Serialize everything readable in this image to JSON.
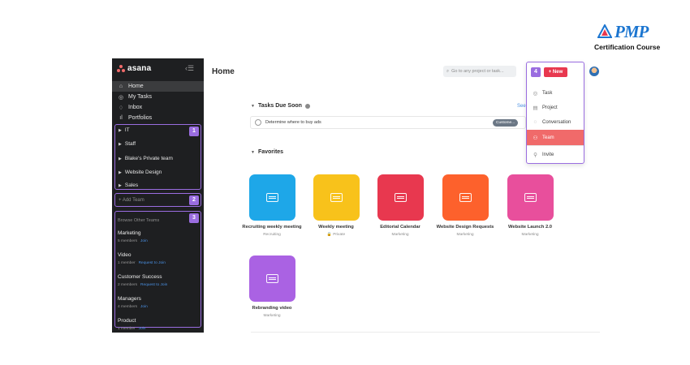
{
  "brand": {
    "name": "PMP",
    "subtitle": "Certification Course",
    "color": "#1b75d0"
  },
  "app": {
    "logo": "asana",
    "accent": "#f06a6a",
    "highlight_color": "#9a6de0"
  },
  "sidebar": {
    "nav": [
      {
        "label": "Home",
        "icon": "home-icon",
        "active": true
      },
      {
        "label": "My Tasks",
        "icon": "check-circle-icon",
        "active": false
      },
      {
        "label": "Inbox",
        "icon": "bell-icon",
        "active": false
      },
      {
        "label": "Portfolios",
        "icon": "bar-chart-icon",
        "active": false
      }
    ],
    "teams": [
      "IT",
      "Staff",
      "Blake's Private team",
      "Website Design",
      "Sales"
    ],
    "add_team": "+ Add Team",
    "browse_header": "Browse Other Teams",
    "browse": [
      {
        "name": "Marketing",
        "meta": "5 members",
        "action": "Join"
      },
      {
        "name": "Video",
        "meta": "1 member",
        "action": "Request to Join"
      },
      {
        "name": "Customer Success",
        "meta": "2 members",
        "action": "Request to Join"
      },
      {
        "name": "Managers",
        "meta": "4 members",
        "action": "Join"
      },
      {
        "name": "Product",
        "meta": "1 member",
        "action": "Join"
      }
    ],
    "callouts": [
      "1",
      "2",
      "3"
    ]
  },
  "main": {
    "title": "Home",
    "search_placeholder": "Go to any project or task...",
    "help_label": "?",
    "tasks_due": {
      "title": "Tasks Due Soon",
      "see_all": "See",
      "task": "Determine where to buy ads",
      "tag": "Custome..."
    },
    "favorites": {
      "title": "Favorites",
      "projects": [
        {
          "name": "Recruiting weekly meeting",
          "meta": "Recruiting",
          "color": "#1ea7e8"
        },
        {
          "name": "Weekly meeting",
          "meta": "Private",
          "color": "#f8c21b"
        },
        {
          "name": "Editorial Calendar",
          "meta": "Marketing",
          "color": "#e8384f"
        },
        {
          "name": "Website Design Requests",
          "meta": "Marketing",
          "color": "#fd612c"
        },
        {
          "name": "Website Launch 2.0",
          "meta": "Marketing",
          "color": "#e84f9c"
        },
        {
          "name": "Rebranding video",
          "meta": "Marketing",
          "color": "#aa62e3"
        }
      ]
    }
  },
  "new_menu": {
    "callout": "4",
    "button": "+ New",
    "items": [
      {
        "label": "Task",
        "icon": "check-circle-icon"
      },
      {
        "label": "Project",
        "icon": "clipboard-icon"
      },
      {
        "label": "Conversation",
        "icon": "speech-bubble-icon"
      },
      {
        "label": "Team",
        "icon": "people-icon",
        "highlighted": true
      },
      {
        "label": "Invite",
        "icon": "person-icon"
      }
    ]
  }
}
